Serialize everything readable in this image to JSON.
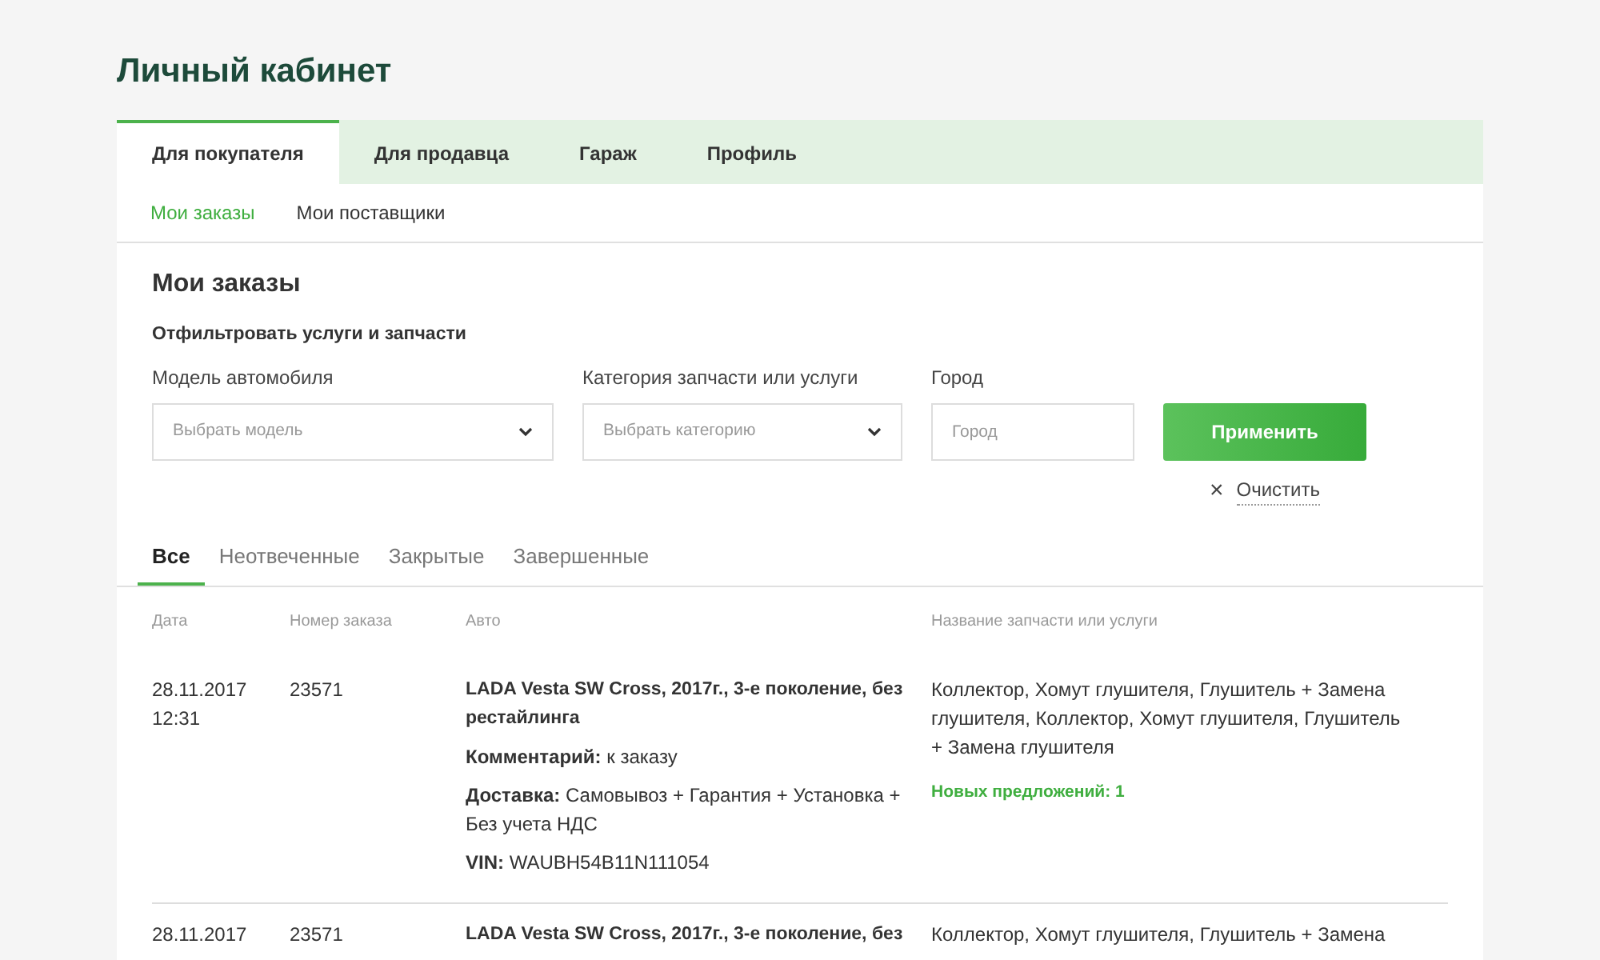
{
  "page_title": "Личный кабинет",
  "tabs": [
    {
      "label": "Для покупателя",
      "selected": true
    },
    {
      "label": "Для продавца",
      "selected": false
    },
    {
      "label": "Гараж",
      "selected": false
    },
    {
      "label": "Профиль",
      "selected": false
    }
  ],
  "subtabs": [
    {
      "label": "Мои заказы",
      "selected": true
    },
    {
      "label": "Мои поставщики",
      "selected": false
    }
  ],
  "section_title": "Мои заказы",
  "filter": {
    "title": "Отфильтровать услуги и запчасти",
    "fields": [
      {
        "kind": "select",
        "label": "Модель автомобиля",
        "placeholder": "Выбрать модель"
      },
      {
        "kind": "select",
        "label": "Категория запчасти или услуги",
        "placeholder": "Выбрать категорию"
      },
      {
        "kind": "input",
        "label": "Город",
        "placeholder": "Город"
      }
    ],
    "apply_button": "Применить",
    "clear_button": "Очистить",
    "clear_icon": "×"
  },
  "status_tabs": [
    {
      "label": "Все",
      "selected": true
    },
    {
      "label": "Неотвеченные",
      "selected": false
    },
    {
      "label": "Закрытые",
      "selected": false
    },
    {
      "label": "Завершенные",
      "selected": false
    }
  ],
  "table": {
    "columns": [
      "Дата",
      "Номер заказа",
      "Авто",
      "Название запчасти или услуги"
    ],
    "rows": [
      {
        "date": [
          "28.11.2017",
          "12:31"
        ],
        "number": "23571",
        "car": "LADA Vesta SW Cross, 2017г., 3-е поколение, без рестайлинга",
        "details": [
          "**Комментарий:**  к заказу",
          "**Доставка:** Самовывоз + Гарантия + Установка + Без учета НДС",
          "**VIN:** WAUBH54B11N111054"
        ],
        "parts": "Коллектор, Хомут глушителя, Глушитель + Замена глушителя, Коллектор, Хомут глушителя, Глушитель + Замена глушителя",
        "offers": "Новых предложений: 1"
      },
      {
        "date": [
          "28.11.2017"
        ],
        "number": "23571",
        "car": "LADA Vesta SW Cross, 2017г., 3-е поколение, без",
        "details": [],
        "parts": "Коллектор, Хомут глушителя, Глушитель + Замена"
      }
    ]
  }
}
